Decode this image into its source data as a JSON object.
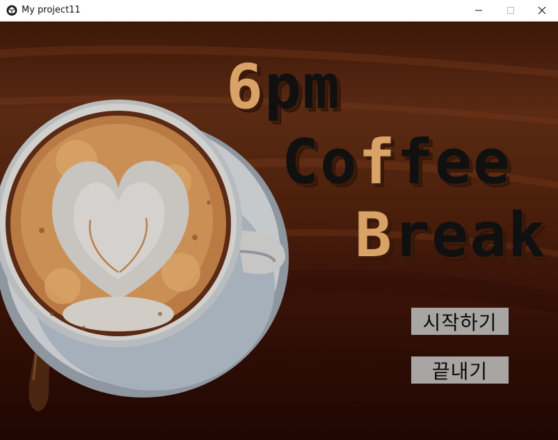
{
  "window": {
    "title": "My project11",
    "icon": "unity-cube-icon",
    "controls": [
      "minimize-icon",
      "maximize-icon",
      "close-icon"
    ]
  },
  "game": {
    "title": {
      "line1": {
        "accent": "6",
        "rest": "pm"
      },
      "line2": {
        "pre": "Co",
        "accent": "f",
        "post": "fee"
      },
      "line3": {
        "accent": "B",
        "rest": "reak"
      }
    },
    "menu": {
      "start_label": "시작하기",
      "quit_label": "끝내기"
    },
    "colors": {
      "accent": "#d9a266",
      "title_text": "#101010",
      "button_bg": "#a8a5a2",
      "background": "#4a1f0b"
    }
  }
}
